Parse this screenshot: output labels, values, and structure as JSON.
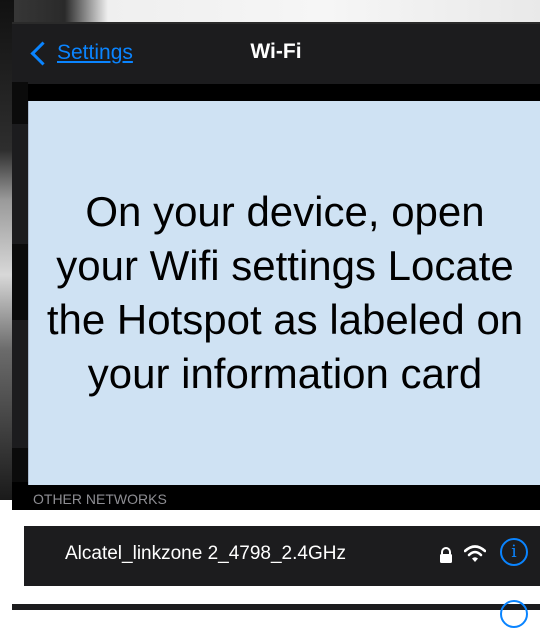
{
  "nav": {
    "back_label": "Settings",
    "title": "Wi-Fi"
  },
  "info_card": {
    "text": "On your device, open your Wifi settings Locate the Hotspot as labeled on your information card"
  },
  "other_networks": {
    "header": "OTHER NETWORKS",
    "items": [
      {
        "name": "Alcatel_linkzone 2_4798_2.4GHz",
        "secured": true,
        "icons": [
          "lock-icon",
          "wifi-icon",
          "info-icon"
        ],
        "info_glyph": "i"
      }
    ]
  },
  "colors": {
    "accent": "#0a84ff",
    "panel": "#cfe2f3",
    "row_bg": "#1c1c1e",
    "secondary_text": "#8e8e93"
  }
}
